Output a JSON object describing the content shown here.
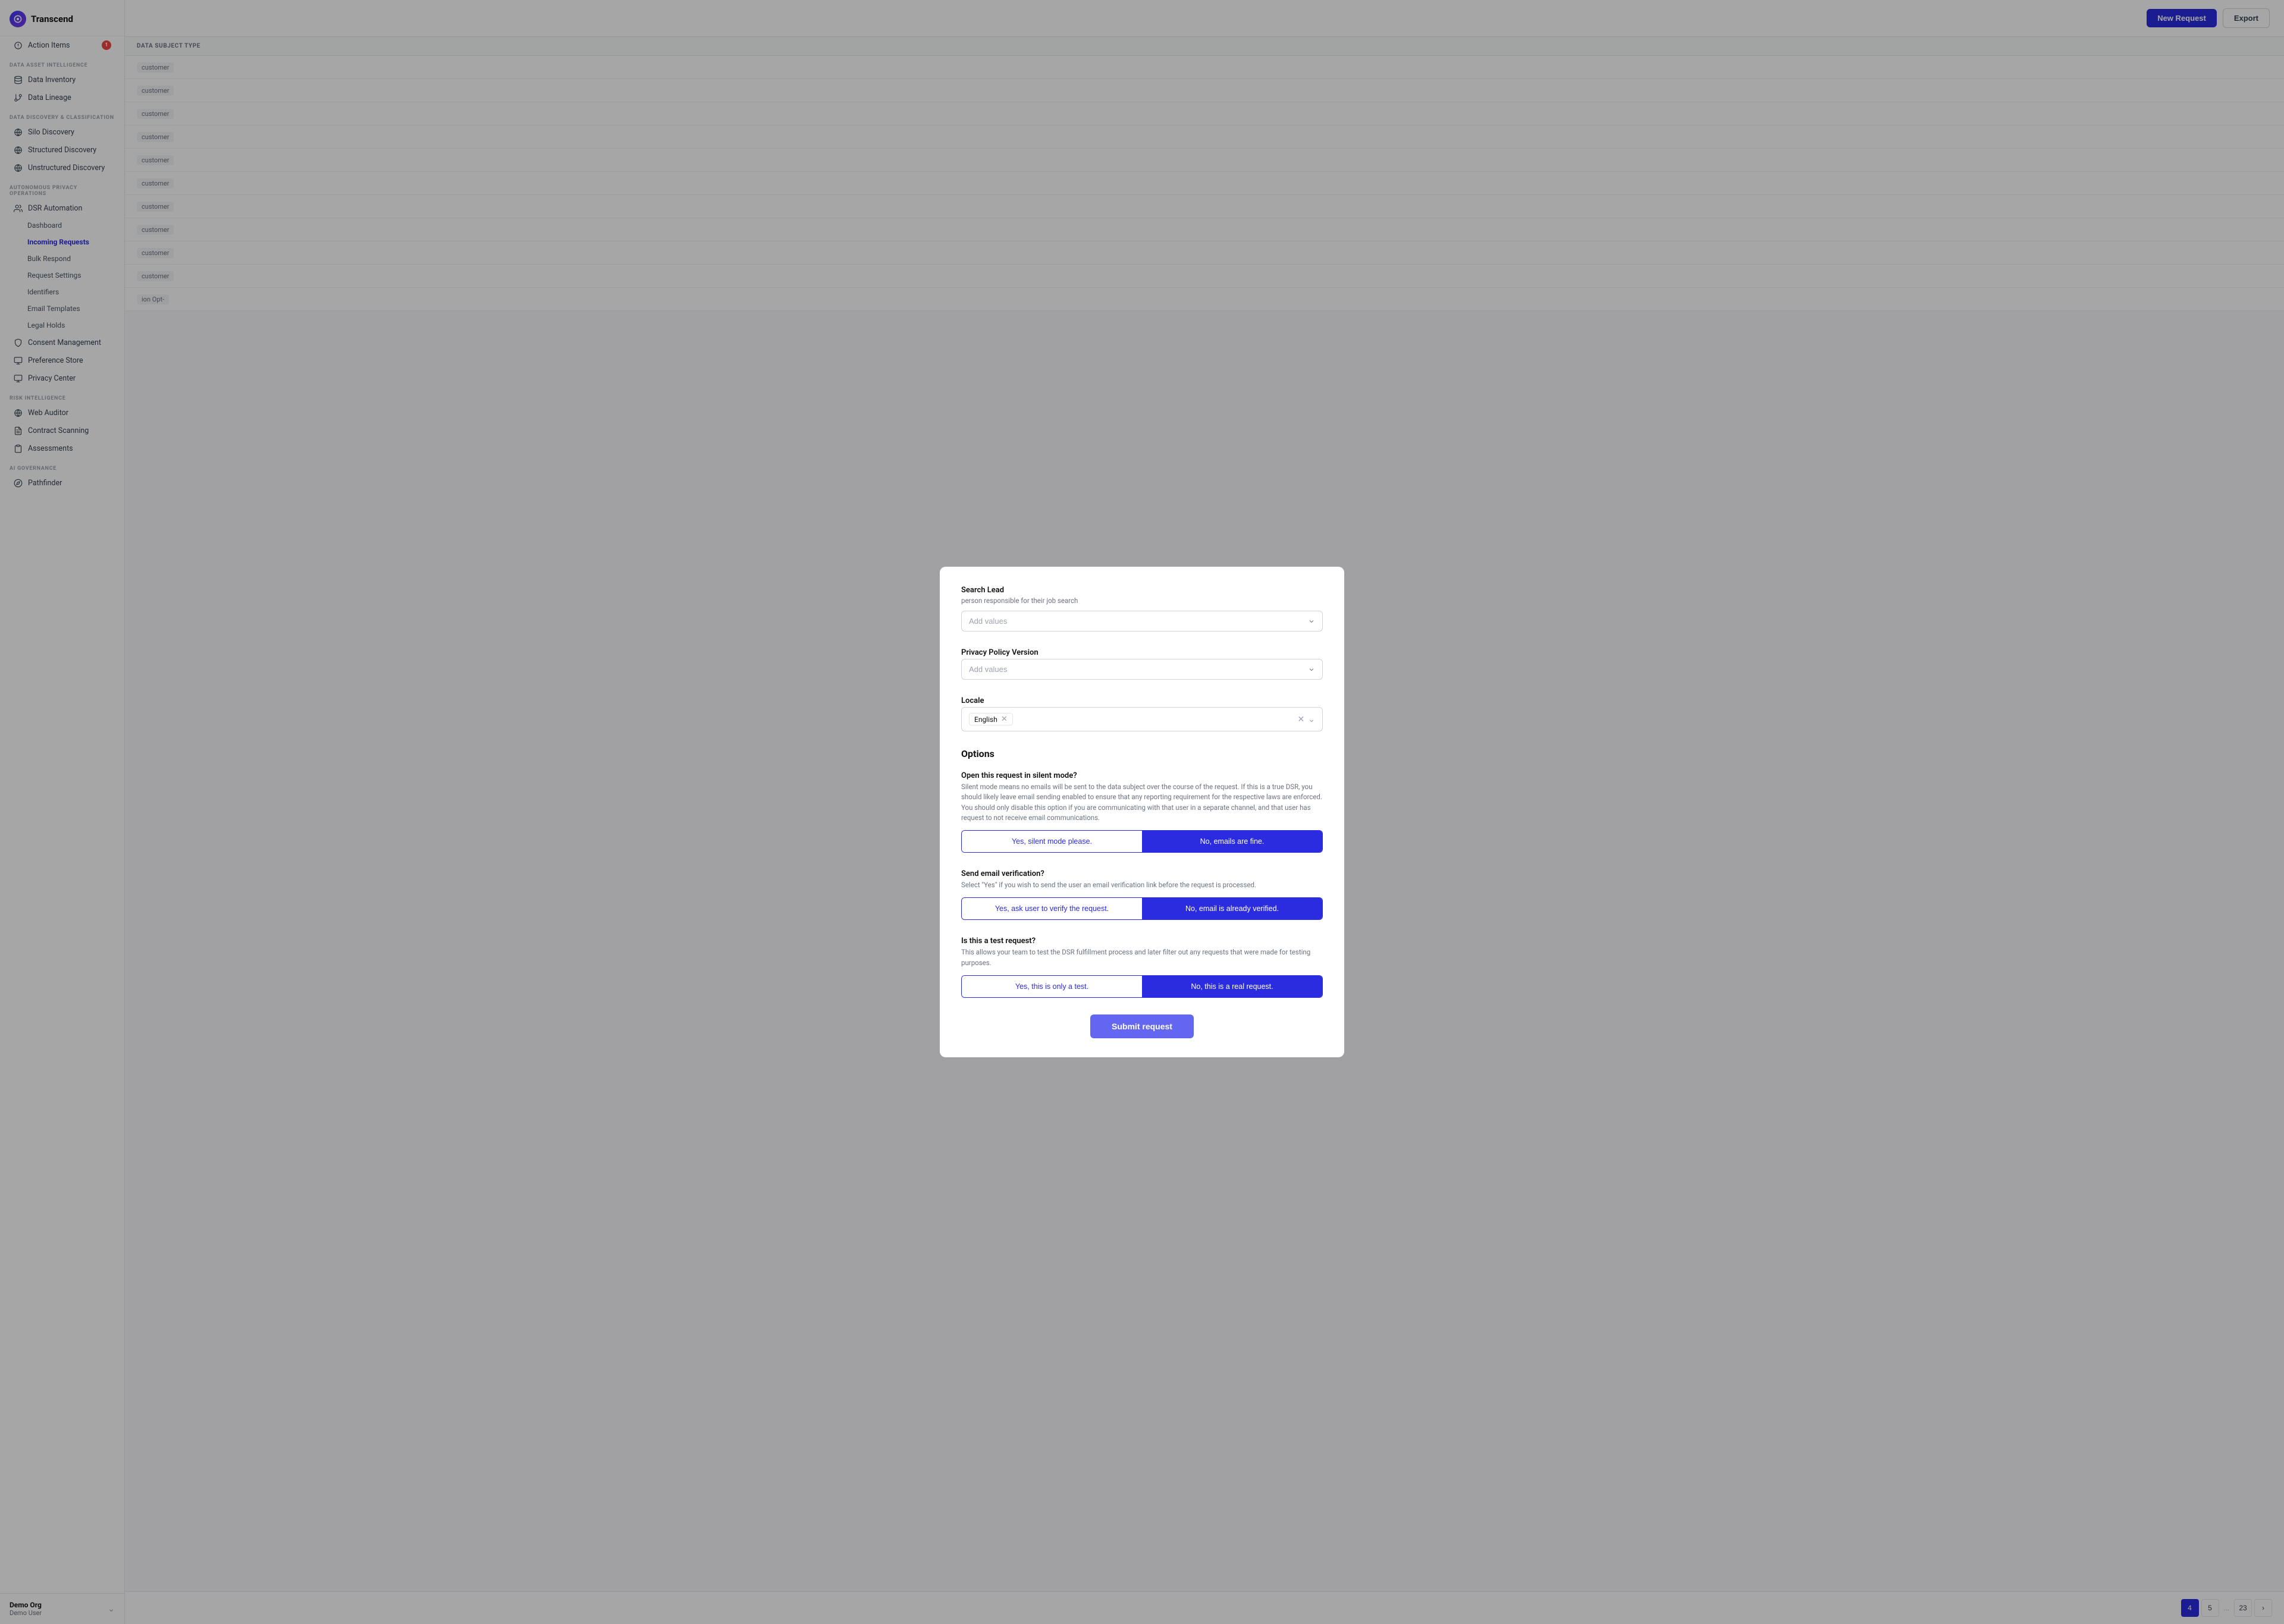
{
  "app": {
    "name": "Transcend"
  },
  "sidebar": {
    "action_items_label": "Action Items",
    "action_items_badge": "1",
    "sections": [
      {
        "label": "DATA ASSET INTELLIGENCE",
        "items": [
          {
            "id": "data-inventory",
            "label": "Data Inventory",
            "icon": "database"
          },
          {
            "id": "data-lineage",
            "label": "Data Lineage",
            "icon": "git-branch"
          }
        ]
      },
      {
        "label": "DATA DISCOVERY & CLASSIFICATION",
        "items": [
          {
            "id": "silo-discovery",
            "label": "Silo Discovery",
            "icon": "globe"
          },
          {
            "id": "structured-discovery",
            "label": "Structured Discovery",
            "icon": "globe"
          },
          {
            "id": "unstructured-discovery",
            "label": "Unstructured Discovery",
            "icon": "globe"
          }
        ]
      },
      {
        "label": "AUTONOMOUS PRIVACY OPERATIONS",
        "items": [
          {
            "id": "dsr-automation",
            "label": "DSR Automation",
            "icon": "users",
            "parent": true
          },
          {
            "id": "dashboard",
            "label": "Dashboard",
            "icon": "",
            "sub": true
          },
          {
            "id": "incoming-requests",
            "label": "Incoming Requests",
            "icon": "",
            "sub": true,
            "active": true
          },
          {
            "id": "bulk-respond",
            "label": "Bulk Respond",
            "icon": "",
            "sub": true
          },
          {
            "id": "request-settings",
            "label": "Request Settings",
            "icon": "",
            "sub": true
          },
          {
            "id": "identifiers",
            "label": "Identifiers",
            "icon": "",
            "sub": true
          },
          {
            "id": "email-templates",
            "label": "Email Templates",
            "icon": "",
            "sub": true
          },
          {
            "id": "legal-holds",
            "label": "Legal Holds",
            "icon": "",
            "sub": true
          },
          {
            "id": "consent-management",
            "label": "Consent Management",
            "icon": "shield"
          },
          {
            "id": "preference-store",
            "label": "Preference Store",
            "icon": "server"
          },
          {
            "id": "privacy-center",
            "label": "Privacy Center",
            "icon": "monitor"
          }
        ]
      },
      {
        "label": "RISK INTELLIGENCE",
        "items": [
          {
            "id": "web-auditor",
            "label": "Web Auditor",
            "icon": "globe"
          },
          {
            "id": "contract-scanning",
            "label": "Contract Scanning",
            "icon": "file-text"
          },
          {
            "id": "assessments",
            "label": "Assessments",
            "icon": "clipboard"
          }
        ]
      },
      {
        "label": "AI GOVERNANCE",
        "items": [
          {
            "id": "pathfinder",
            "label": "Pathfinder",
            "icon": "compass"
          }
        ]
      }
    ],
    "footer": {
      "org": "Demo Org",
      "user": "Demo User"
    }
  },
  "topbar": {
    "new_request_label": "New Request",
    "export_label": "Export"
  },
  "table": {
    "column_header": "DATA SUBJECT TYPE",
    "rows": [
      {
        "type": "customer"
      },
      {
        "type": "customer"
      },
      {
        "type": "customer"
      },
      {
        "type": "customer"
      },
      {
        "type": "customer"
      },
      {
        "type": "customer"
      },
      {
        "type": "customer"
      },
      {
        "type": "customer"
      },
      {
        "type": "customer"
      },
      {
        "type": "customer"
      },
      {
        "type": "ion Opt-"
      }
    ]
  },
  "pagination": {
    "pages": [
      "4",
      "5",
      "23"
    ],
    "dots": "...",
    "next_label": "›"
  },
  "modal": {
    "search_lead": {
      "label": "Search Lead",
      "sublabel": "person responsible for their job search",
      "placeholder": "Add values"
    },
    "privacy_policy_version": {
      "label": "Privacy Policy Version",
      "placeholder": "Add values"
    },
    "locale": {
      "label": "Locale",
      "selected_value": "English"
    },
    "options": {
      "heading": "Options",
      "silent_mode": {
        "title": "Open this request in silent mode?",
        "description": "Silent mode means no emails will be sent to the data subject over the course of the request. If this is a true DSR, you should likely leave email sending enabled to ensure that any reporting requirement for the respective laws are enforced. You should only disable this option if you are communicating with that user in a separate channel, and that user has request to not receive email communications.",
        "option_yes": "Yes, silent mode please.",
        "option_no": "No, emails are fine.",
        "selected": "no"
      },
      "email_verification": {
        "title": "Send email verification?",
        "description": "Select \"Yes\" if you wish to send the user an email verification link before the request is processed.",
        "option_yes": "Yes, ask user to verify the request.",
        "option_no": "No, email is already verified.",
        "selected": "no"
      },
      "test_request": {
        "title": "Is this a test request?",
        "description": "This allows your team to test the DSR fulfillment process and later filter out any requests that were made for testing purposes.",
        "option_yes": "Yes, this is only a test.",
        "option_no": "No, this is a real request.",
        "selected": "no"
      }
    },
    "submit_label": "Submit request"
  }
}
